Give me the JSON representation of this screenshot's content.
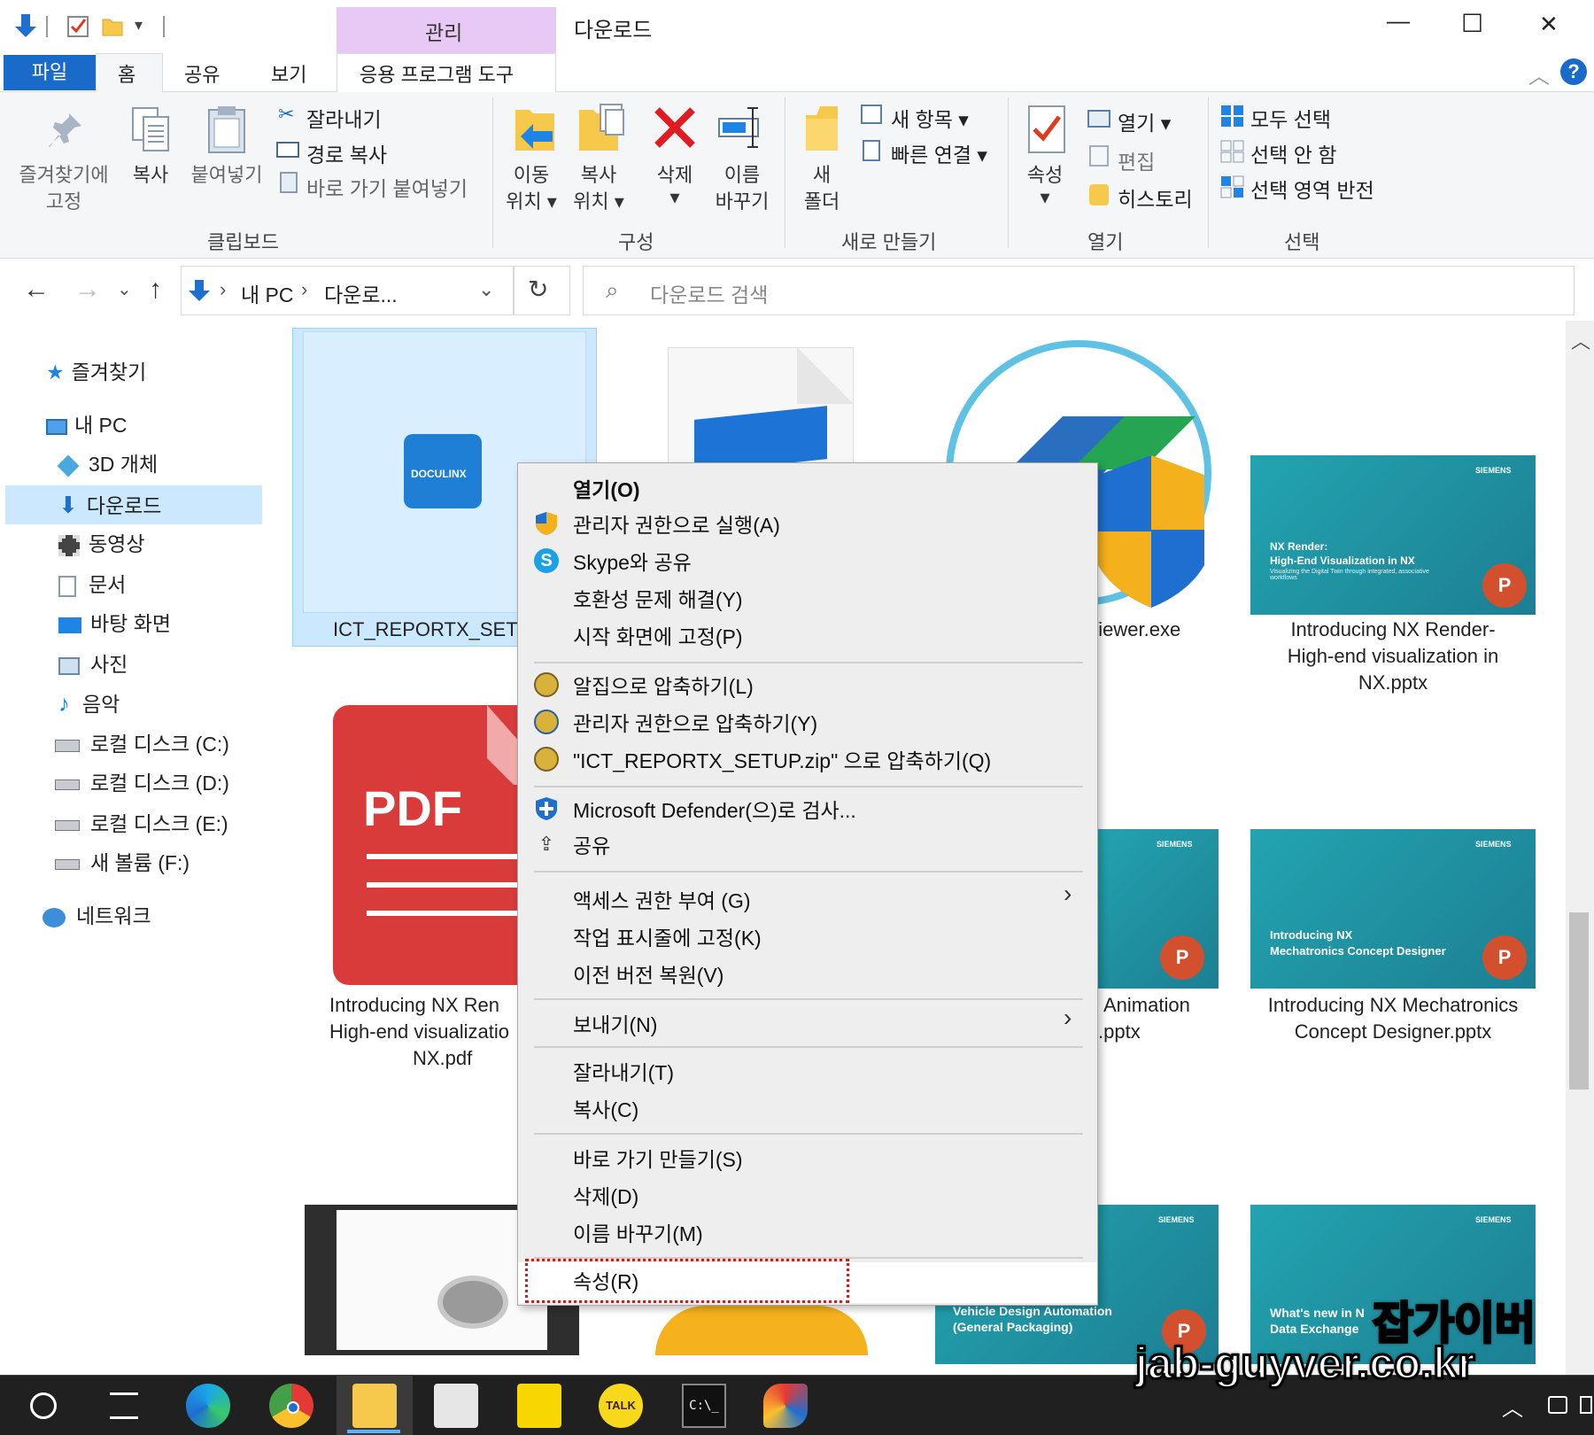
{
  "window": {
    "title": "다운로드",
    "context_tab_header": "관리",
    "controls": {
      "minimize": "—",
      "maximize": "☐",
      "close": "✕"
    }
  },
  "ribbon_tabs": {
    "file": "파일",
    "home": "홈",
    "share": "공유",
    "view": "보기",
    "app_tools": "응용 프로그램 도구"
  },
  "ribbon": {
    "clipboard": {
      "pin_line1": "즐겨찾기에",
      "pin_line2": "고정",
      "copy": "복사",
      "paste": "붙여넣기",
      "cut": "잘라내기",
      "copy_path": "경로 복사",
      "paste_shortcut": "바로 가기 붙여넣기",
      "group": "클립보드"
    },
    "organize": {
      "move_line1": "이동",
      "move_line2": "위치 ▾",
      "copyto_line1": "복사",
      "copyto_line2": "위치 ▾",
      "delete_line1": "삭제",
      "delete_line2": "▾",
      "rename_line1": "이름",
      "rename_line2": "바꾸기",
      "group": "구성"
    },
    "new": {
      "folder_line1": "새",
      "folder_line2": "폴더",
      "new_item": "새 항목 ▾",
      "easy_access": "빠른 연결 ▾",
      "group": "새로 만들기"
    },
    "open": {
      "props_line1": "속성",
      "props_line2": "▾",
      "open": "열기 ▾",
      "edit": "편집",
      "history": "히스토리",
      "group": "열기"
    },
    "select": {
      "select_all": "모두 선택",
      "select_none": "선택 안 함",
      "invert": "선택 영역 반전",
      "group": "선택"
    }
  },
  "address": {
    "crumb_pc": "내 PC",
    "crumb_sep": "›",
    "crumb_folder": "다운로...",
    "search_placeholder": "다운로드 검색"
  },
  "nav": {
    "items": [
      {
        "label": "즐겨찾기",
        "icon": "star-icon"
      },
      {
        "label": "내 PC",
        "icon": "pc-icon"
      },
      {
        "label": "3D 개체",
        "icon": "cube-icon"
      },
      {
        "label": "다운로드",
        "icon": "download-icon"
      },
      {
        "label": "동영상",
        "icon": "film-icon"
      },
      {
        "label": "문서",
        "icon": "document-icon"
      },
      {
        "label": "바탕 화면",
        "icon": "desktop-icon"
      },
      {
        "label": "사진",
        "icon": "picture-icon"
      },
      {
        "label": "음악",
        "icon": "music-icon"
      },
      {
        "label": "로컬 디스크 (C:)",
        "icon": "disk-icon"
      },
      {
        "label": "로컬 디스크 (D:)",
        "icon": "disk-icon"
      },
      {
        "label": "로컬 디스크 (E:)",
        "icon": "disk-icon"
      },
      {
        "label": "새 볼륨 (F:)",
        "icon": "disk-icon"
      },
      {
        "label": "네트워크",
        "icon": "network-icon"
      }
    ]
  },
  "files": [
    {
      "name_line1": "ICT_REPORTX_SETUP",
      "name_line2": "",
      "name_line3": "",
      "docuwork_logo": "DOCULINX"
    },
    {
      "name_line1": "",
      "name_line2": "",
      "name_line3": ""
    },
    {
      "name_line1": "Viewer.exe",
      "name_line2": "",
      "name_line3": ""
    },
    {
      "name_line1": "Introducing NX Render-",
      "name_line2": "High-end visualization in",
      "name_line3": "NX.pptx",
      "slide_text1": "NX Render:",
      "slide_text2": "High-End Visualization in NX",
      "slide_text3": "Visualizing the Digital Twin through integrated, associative workflows",
      "brand": "SIEMENS",
      "ppt_badge": "P"
    },
    {
      "name_line1": "Introducing NX Ren",
      "name_line2": "High-end visualizatio",
      "name_line3": "NX.pdf",
      "pdf_text": "PDF"
    },
    {
      "name_line1": "Animation",
      "name_line2": ".pptx",
      "name_line3": "",
      "brand": "SIEMENS",
      "ppt_badge": "P"
    },
    {
      "name_line1": "Introducing NX Mechatronics",
      "name_line2": "Concept Designer.pptx",
      "name_line3": "",
      "slide_text1": "Introducing NX",
      "slide_text2": "Mechatronics Concept Designer",
      "brand": "SIEMENS",
      "ppt_badge": "P"
    },
    {
      "slide_text1": "Vehicle Design Automation",
      "slide_text2": "(General Packaging)",
      "brand": "SIEMENS",
      "ppt_badge": "P"
    },
    {
      "slide_text1": "What's new in N",
      "slide_text2": "Data Exchange",
      "brand": "SIEMENS"
    }
  ],
  "context_menu": {
    "open": "열기(O)",
    "run_as_admin": "관리자 권한으로 실행(A)",
    "share_skype": "Skype와 공유",
    "troubleshoot": "호환성 문제 해결(Y)",
    "pin_start": "시작 화면에 고정(P)",
    "alzip_compress": "알집으로 압축하기(L)",
    "admin_compress": "관리자 권한으로 압축하기(Y)",
    "compress_zip": "\"ICT_REPORTX_SETUP.zip\" 으로 압축하기(Q)",
    "defender": "Microsoft Defender(으)로 검사...",
    "share": "공유",
    "give_access": "액세스 권한 부여 (G)",
    "pin_taskbar": "작업 표시줄에 고정(K)",
    "restore_versions": "이전 버전 복원(V)",
    "send_to": "보내기(N)",
    "cut": "잘라내기(T)",
    "copy": "복사(C)",
    "create_shortcut": "바로 가기 만들기(S)",
    "delete": "삭제(D)",
    "rename": "이름 바꾸기(M)",
    "properties": "속성(R)"
  },
  "watermark": {
    "line1": "잡가이버",
    "line2": "jab-guyver.co.kr"
  },
  "colors": {
    "accent": "#1a6bc9",
    "selection": "#cce8ff",
    "highlight_dash": "#d21d1d",
    "mgmt_tab": "#e8c8f4"
  }
}
